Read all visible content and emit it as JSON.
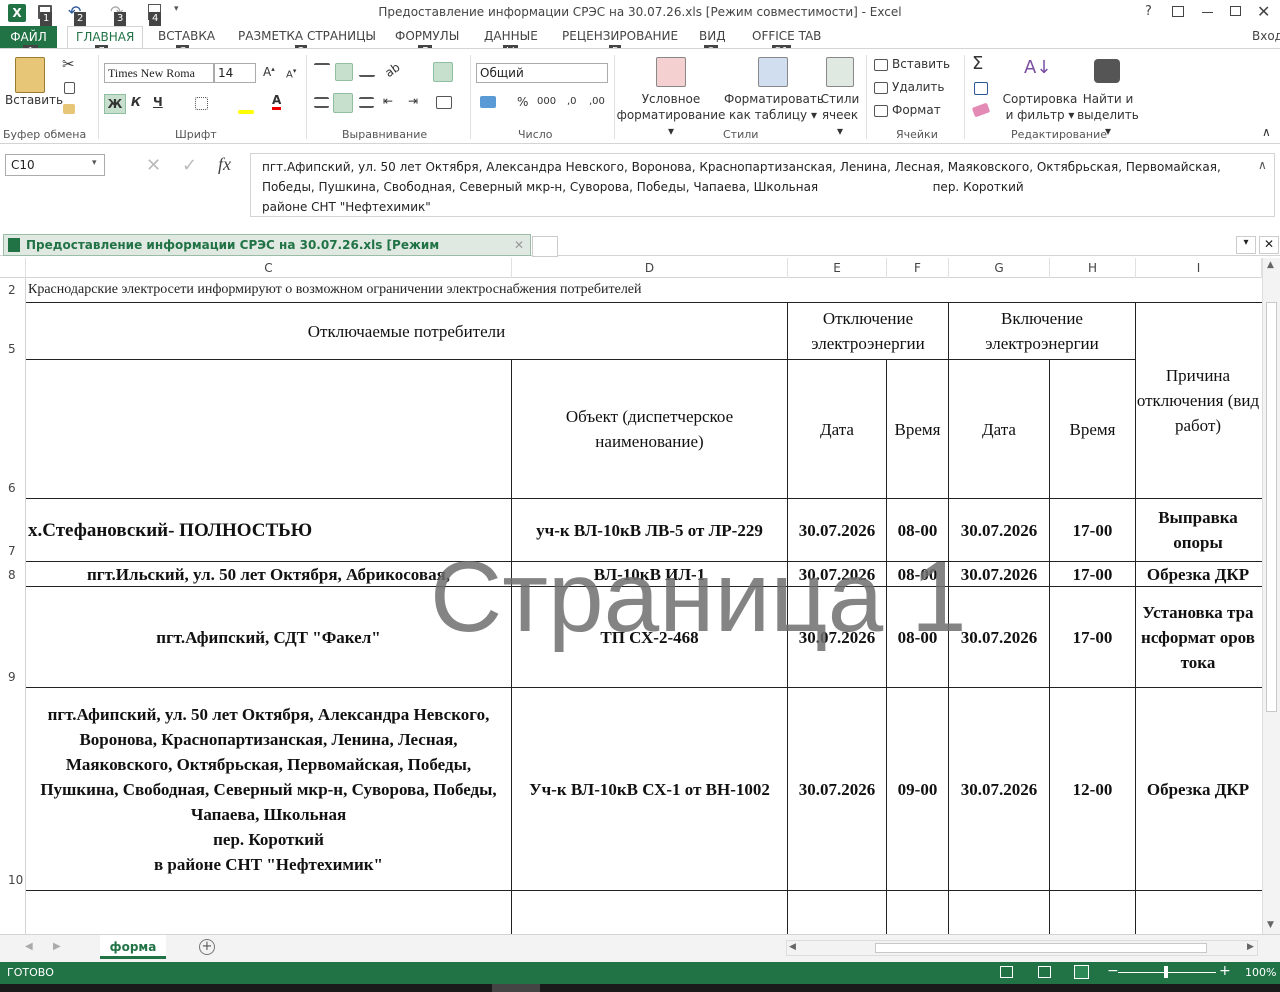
{
  "window": {
    "title": "Предоставление информации СРЭС на 30.07.26.xls  [Режим совместимости] - Excel",
    "qat_keytips": [
      "1",
      "2",
      "3",
      "4"
    ],
    "help": "?",
    "signin": "Вход"
  },
  "tabs": {
    "file": "ФАЙЛ",
    "file_key": "Ф",
    "items": [
      {
        "label": "ГЛАВНАЯ",
        "key": "Я"
      },
      {
        "label": "ВСТАВКА",
        "key": "С"
      },
      {
        "label": "РАЗМЕТКА СТРАНИЦЫ",
        "key": "З"
      },
      {
        "label": "ФОРМУЛЫ",
        "key": "Л"
      },
      {
        "label": "ДАННЫЕ",
        "key": "Ы"
      },
      {
        "label": "РЕЦЕНЗИРОВАНИЕ",
        "key": "Р"
      },
      {
        "label": "ВИД",
        "key": "О"
      },
      {
        "label": "OFFICE TAB",
        "key": "Э1"
      }
    ]
  },
  "ribbon": {
    "clipboard": {
      "paste": "Вставить",
      "group": "Буфер обмена"
    },
    "font": {
      "name": "Times New Roma",
      "size": "14",
      "group": "Шрифт",
      "bold": "Ж",
      "italic": "К",
      "underline": "Ч"
    },
    "alignment": {
      "group": "Выравнивание"
    },
    "number": {
      "format": "Общий",
      "group": "Число",
      "percent": "%",
      "thousands": "000"
    },
    "styles": {
      "conditional": [
        "Условное",
        "форматирование"
      ],
      "table": [
        "Форматировать",
        "как таблицу"
      ],
      "cell": [
        "Стили",
        "ячеек"
      ],
      "group": "Стили"
    },
    "cells": {
      "insert": "Вставить",
      "delete": "Удалить",
      "format": "Формат",
      "group": "Ячейки"
    },
    "editing": {
      "sort": [
        "Сортировка",
        "и фильтр"
      ],
      "find": [
        "Найти и",
        "выделить"
      ],
      "group": "Редактирование"
    }
  },
  "formula_bar": {
    "name_box": "C10",
    "fx": "fx",
    "content_lines": [
      "пгт.Афипский, ул. 50 лет Октября, Александра Невского, Воронова, Краснопартизанская, Ленина, Лесная, Маяковского, Октябрьская, Первомайская,",
      "Победы, Пушкина, Свободная, Северный мкр-н, Суворова, Победы, Чапаева, Школьная                              пер. Короткий                                                                          в",
      "районе СНТ \"Нефтехимик\""
    ]
  },
  "workbook_tab": "Предоставление информации СРЭС на 30.07.26.xls  [Режим совместимости]",
  "columns": [
    "C",
    "D",
    "E",
    "F",
    "G",
    "H",
    "I"
  ],
  "rows": [
    "2",
    "5",
    "6",
    "7",
    "8",
    "9",
    "10"
  ],
  "sheet": {
    "notice": "Краснодарские электросети информируют о возможном ограничении электроснабжения потребителей",
    "h_consumers": "Отключаемые потребители",
    "h_off": "Отключение электроэнергии",
    "h_on": "Включение электроэнергии",
    "h_reason": "Причина отключения (вид работ)",
    "h_object": "Объект (диспетчерское наименование)",
    "h_date": "Дата",
    "h_time": "Время",
    "data": [
      {
        "consumers": "х.Стефановский- ПОЛНОСТЬЮ",
        "object": "уч-к  ВЛ-10кВ ЛВ-5 от ЛР-229",
        "off_date": "30.07.2026",
        "off_time": "08-00",
        "on_date": "30.07.2026",
        "on_time": "17-00",
        "reason": "Выправка опоры"
      },
      {
        "consumers": "пгт.Ильский, ул. 50 лет Октября, Абрикосовая,",
        "object": "ВЛ-10кВ ИЛ-1",
        "off_date": "30.07.2026",
        "off_time": "08-00",
        "on_date": "30.07.2026",
        "on_time": "17-00",
        "reason": "Обрезка ДКР"
      },
      {
        "consumers": "пгт.Афипский,  СДТ \"Факел\"",
        "object": "ТП СХ-2-468",
        "off_date": "30.07.2026",
        "off_time": "08-00",
        "on_date": "30.07.2026",
        "on_time": "17-00",
        "reason": "Установка трансформат оров тока"
      },
      {
        "consumers": "пгт.Афипский, ул. 50 лет Октября, Александра Невского, Воронова, Краснопартизанская, Ленина, Лесная, Маяковского, Октябрьская, Первомайская, Победы, Пушкина, Свободная, Северный мкр-н, Суворова, Победы, Чапаева, Школьная\nпер. Короткий\nв районе СНТ \"Нефтехимик\"",
        "object": "Уч-к ВЛ-10кВ СХ-1 от ВН-1002",
        "off_date": "30.07.2026",
        "off_time": "09-00",
        "on_date": "30.07.2026",
        "on_time": "12-00",
        "reason": "Обрезка ДКР"
      }
    ]
  },
  "page_watermark": "Страница 1",
  "sheet_tabs": {
    "active": "форма"
  },
  "status": {
    "ready": "ГОТОВО",
    "zoom": "100%"
  }
}
